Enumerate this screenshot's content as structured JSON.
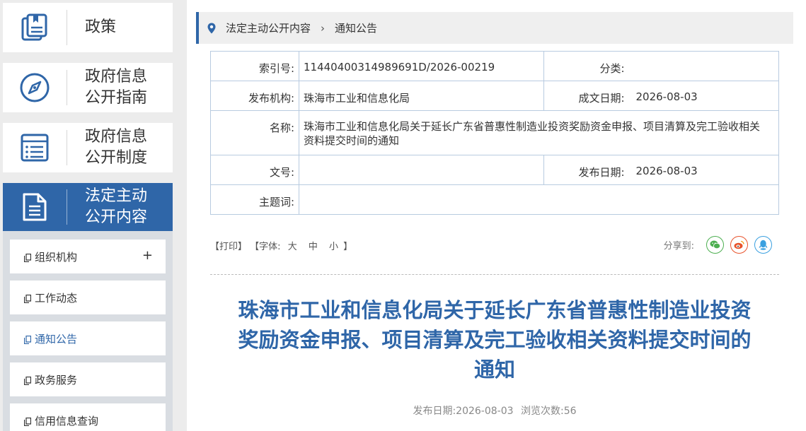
{
  "sidebar": {
    "nav": [
      {
        "label": "政策",
        "icon": "policy-book-icon"
      },
      {
        "label": "政府信息公开指南",
        "line1": "政府信息",
        "line2": "公开指南",
        "icon": "compass-icon"
      },
      {
        "label": "政府信息公开制度",
        "line1": "政府信息",
        "line2": "公开制度",
        "icon": "list-document-icon"
      },
      {
        "label": "法定主动公开内容",
        "line1": "法定主动",
        "line2": "公开内容",
        "icon": "document-icon"
      }
    ],
    "sub_items": [
      {
        "label": "组织机构",
        "expand": "+"
      },
      {
        "label": "工作动态"
      },
      {
        "label": "通知公告"
      },
      {
        "label": "政务服务"
      },
      {
        "label": "信用信息查询"
      }
    ]
  },
  "breadcrumb": {
    "items": [
      "法定主动公开内容",
      "通知公告"
    ],
    "separator": "›"
  },
  "info_table": {
    "index_label": "索引号:",
    "index_value": "11440400314989691D/2026-00219",
    "category_label": "分类:",
    "category_value": "",
    "publisher_label": "发布机构:",
    "publisher_value": "珠海市工业和信息化局",
    "created_label": "成文日期:",
    "created_value": "2026-08-03",
    "name_label": "名称:",
    "name_value": "珠海市工业和信息化局关于延长广东省普惠性制造业投资奖励资金申报、项目清算及完工验收相关资料提交时间的通知",
    "docno_label": "文号:",
    "docno_value": "",
    "published_label": "发布日期:",
    "published_value": "2026-08-03",
    "keywords_label": "主题词:",
    "keywords_value": ""
  },
  "tools": {
    "print": "【打印】",
    "font_prefix": "【字体:",
    "font_large": "大",
    "font_medium": "中",
    "font_small": "小",
    "font_suffix": "】"
  },
  "share": {
    "label": "分享到:",
    "icons": [
      "wechat-icon",
      "weibo-icon",
      "qq-icon"
    ],
    "colors": {
      "wechat": "#4caf50",
      "weibo": "#e8542d",
      "qq": "#3aa0e0"
    }
  },
  "article": {
    "title": "珠海市工业和信息化局关于延长广东省普惠性制造业投资奖励资金申报、项目清算及完工验收相关资料提交时间的通知",
    "title_line1": "珠海市工业和信息化局关于延长广东省普惠性制造业投资",
    "title_line2": "奖励资金申报、项目清算及完工验收相关资料提交时间的",
    "title_line3": "通知",
    "meta_date_label": "发布日期:",
    "meta_date": "2026-08-03",
    "meta_views_label": "浏览次数:",
    "meta_views": "56"
  },
  "colors": {
    "accent": "#2f66a8",
    "border": "#b8cbe0"
  }
}
